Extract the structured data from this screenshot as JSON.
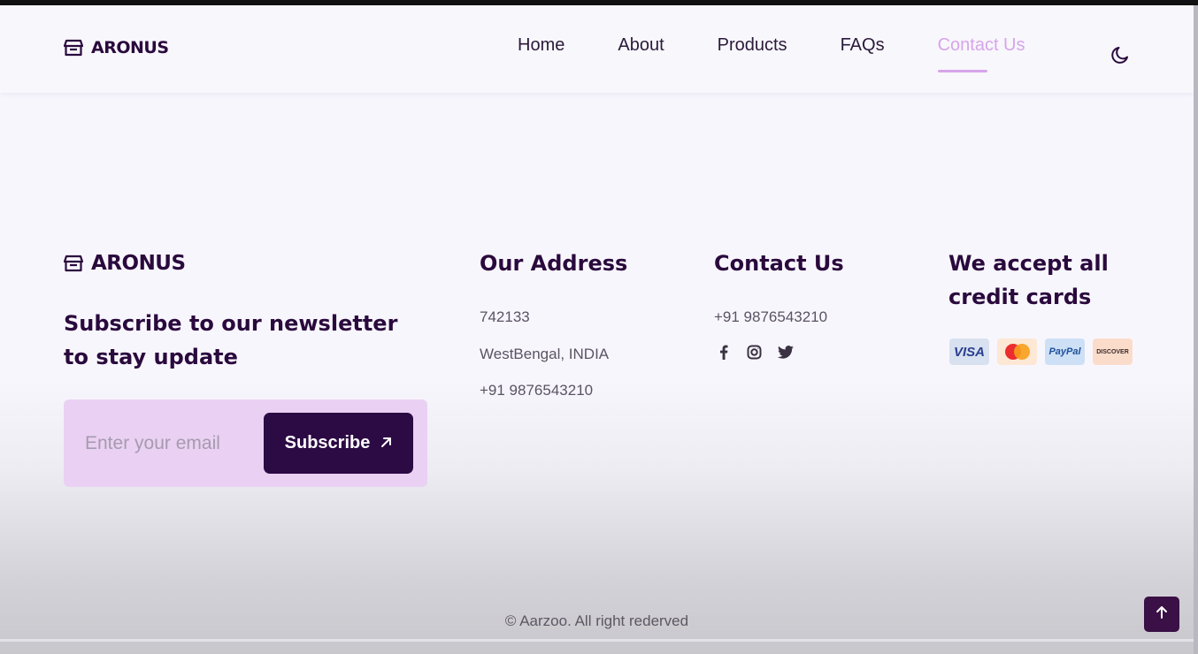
{
  "brand": {
    "name": "ARONUS",
    "logo_icon": "store-icon"
  },
  "nav": {
    "items": [
      {
        "label": "Home",
        "active": false
      },
      {
        "label": "About",
        "active": false
      },
      {
        "label": "Products",
        "active": false
      },
      {
        "label": "FAQs",
        "active": false
      },
      {
        "label": "Contact Us",
        "active": true
      }
    ],
    "theme_toggle_icon": "moon-icon",
    "active_color": "#d6a5ea"
  },
  "footer": {
    "brand": "ARONUS",
    "newsletter": {
      "heading": "Subscribe to our newsletter to stay update",
      "email_placeholder": "Enter your email",
      "email_value": "",
      "button_label": "Subscribe",
      "button_icon": "arrow-up-right-icon",
      "button_color": "#2c0a44",
      "box_color": "#ead1f3"
    },
    "address": {
      "heading": "Our Address",
      "lines": [
        "742133",
        "WestBengal, INDIA",
        "+91 9876543210"
      ]
    },
    "contact": {
      "heading": "Contact Us",
      "phone": "+91 9876543210",
      "social_icons": [
        "facebook-icon",
        "instagram-icon",
        "twitter-icon"
      ]
    },
    "payments": {
      "heading": "We accept all credit cards",
      "cards": [
        {
          "name": "visa-card-icon",
          "label": "VISA"
        },
        {
          "name": "mastercard-card-icon",
          "label": ""
        },
        {
          "name": "paypal-card-icon",
          "label": "PayPal"
        },
        {
          "name": "discover-card-icon",
          "label": "DISCOVER"
        }
      ]
    },
    "copyright": "© Aarzoo. All right rederved",
    "scroll_top_icon": "arrow-up-icon"
  }
}
